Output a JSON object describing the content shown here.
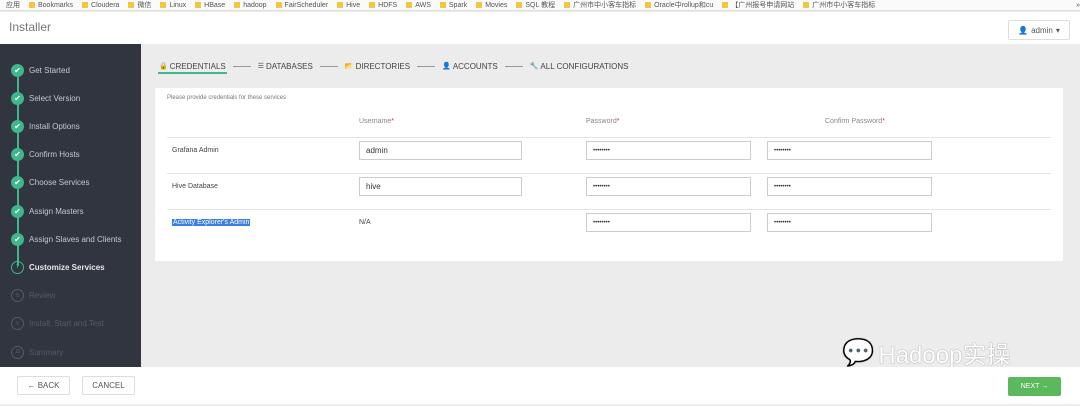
{
  "bookmarks": [
    "应用",
    "Bookmarks",
    "Cloudera",
    "微信",
    "Linux",
    "HBase",
    "hadoop",
    "FairScheduler",
    "Hive",
    "HDFS",
    "AWS",
    "Spark",
    "Movies",
    "SQL 教程",
    "广州市中小客车指标",
    "Oracle中rollup和cu",
    "【广州报号申请网站",
    "广州市中小客车指标",
    "»"
  ],
  "header": {
    "title": "Installer",
    "user": "admin"
  },
  "sidebar": [
    {
      "num": "✔",
      "label": "Get Started",
      "state": "done"
    },
    {
      "num": "✔",
      "label": "Select Version",
      "state": "done"
    },
    {
      "num": "✔",
      "label": "Install Options",
      "state": "done"
    },
    {
      "num": "✔",
      "label": "Confirm Hosts",
      "state": "done"
    },
    {
      "num": "✔",
      "label": "Choose Services",
      "state": "done"
    },
    {
      "num": "✔",
      "label": "Assign Masters",
      "state": "done"
    },
    {
      "num": "✔",
      "label": "Assign Slaves and Clients",
      "state": "done"
    },
    {
      "num": "7",
      "label": "Customize Services",
      "state": "current"
    },
    {
      "num": "8",
      "label": "Review",
      "state": "future"
    },
    {
      "num": "9",
      "label": "Install, Start and Test",
      "state": "future"
    },
    {
      "num": "10",
      "label": "Summary",
      "state": "future"
    }
  ],
  "tabs": [
    {
      "icon": "lock",
      "label": "CREDENTIALS"
    },
    {
      "icon": "list",
      "label": "DATABASES"
    },
    {
      "icon": "folder",
      "label": "DIRECTORIES"
    },
    {
      "icon": "user",
      "label": "ACCOUNTS"
    },
    {
      "icon": "wrench",
      "label": "ALL CONFIGURATIONS"
    }
  ],
  "panel": {
    "intro": "Please provide credentials for these services",
    "headers": {
      "username": "Username",
      "password": "Password",
      "confirm": "Confirm Password",
      "required": "*"
    },
    "rows": [
      {
        "name": "Grafana Admin",
        "username": "admin",
        "password": "••••••••",
        "confirm": "••••••••"
      },
      {
        "name": "Hive Database",
        "username": "hive",
        "password": "••••••••",
        "confirm": "••••••••"
      },
      {
        "name": "Activity Explorer's Admin",
        "username": "N/A",
        "password": "••••••••",
        "confirm": "••••••••"
      }
    ]
  },
  "footer": {
    "back": "← BACK",
    "cancel": "CANCEL",
    "next": "NEXT →"
  },
  "watermark": "Hadoop实操"
}
